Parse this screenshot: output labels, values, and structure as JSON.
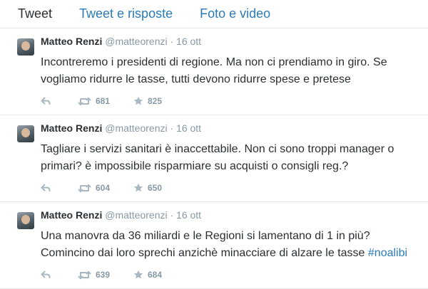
{
  "tabs": [
    {
      "label": "Tweet",
      "active": true
    },
    {
      "label": "Tweet e risposte",
      "active": false
    },
    {
      "label": "Foto e video",
      "active": false
    }
  ],
  "icons": {
    "reply": "reply-icon",
    "retweet": "retweet-icon",
    "favorite": "star-icon"
  },
  "colors": {
    "link": "#2b7bb9",
    "muted": "#8899a6",
    "text": "#292f33",
    "divider": "#e1e8ed"
  },
  "tweets": [
    {
      "name": "Matteo Renzi",
      "handle": "@matteorenzi",
      "separator": "·",
      "date": "16 ott",
      "line1": "Incontreremo i presidenti di regione. Ma non ci prendiamo in giro. Se",
      "line2": "vogliamo ridurre le tasse, tutti devono ridurre spese e pretese",
      "hashtag": "",
      "retweets": "681",
      "favorites": "825"
    },
    {
      "name": "Matteo Renzi",
      "handle": "@matteorenzi",
      "separator": "·",
      "date": "16 ott",
      "line1": "Tagliare i servizi sanitari è inaccettabile. Non ci sono troppi manager o",
      "line2": "primari? è impossibile risparmiare su acquisti o consigli reg.?",
      "hashtag": "",
      "retweets": "604",
      "favorites": "650"
    },
    {
      "name": "Matteo Renzi",
      "handle": "@matteorenzi",
      "separator": "·",
      "date": "16 ott",
      "line1": "Una manovra da 36 miliardi e le Regioni si lamentano di 1 in più?",
      "line2": "Comincino dai loro sprechi anzichè minacciare di alzare le tasse ",
      "hashtag": "#noalibi",
      "retweets": "639",
      "favorites": "684"
    }
  ]
}
